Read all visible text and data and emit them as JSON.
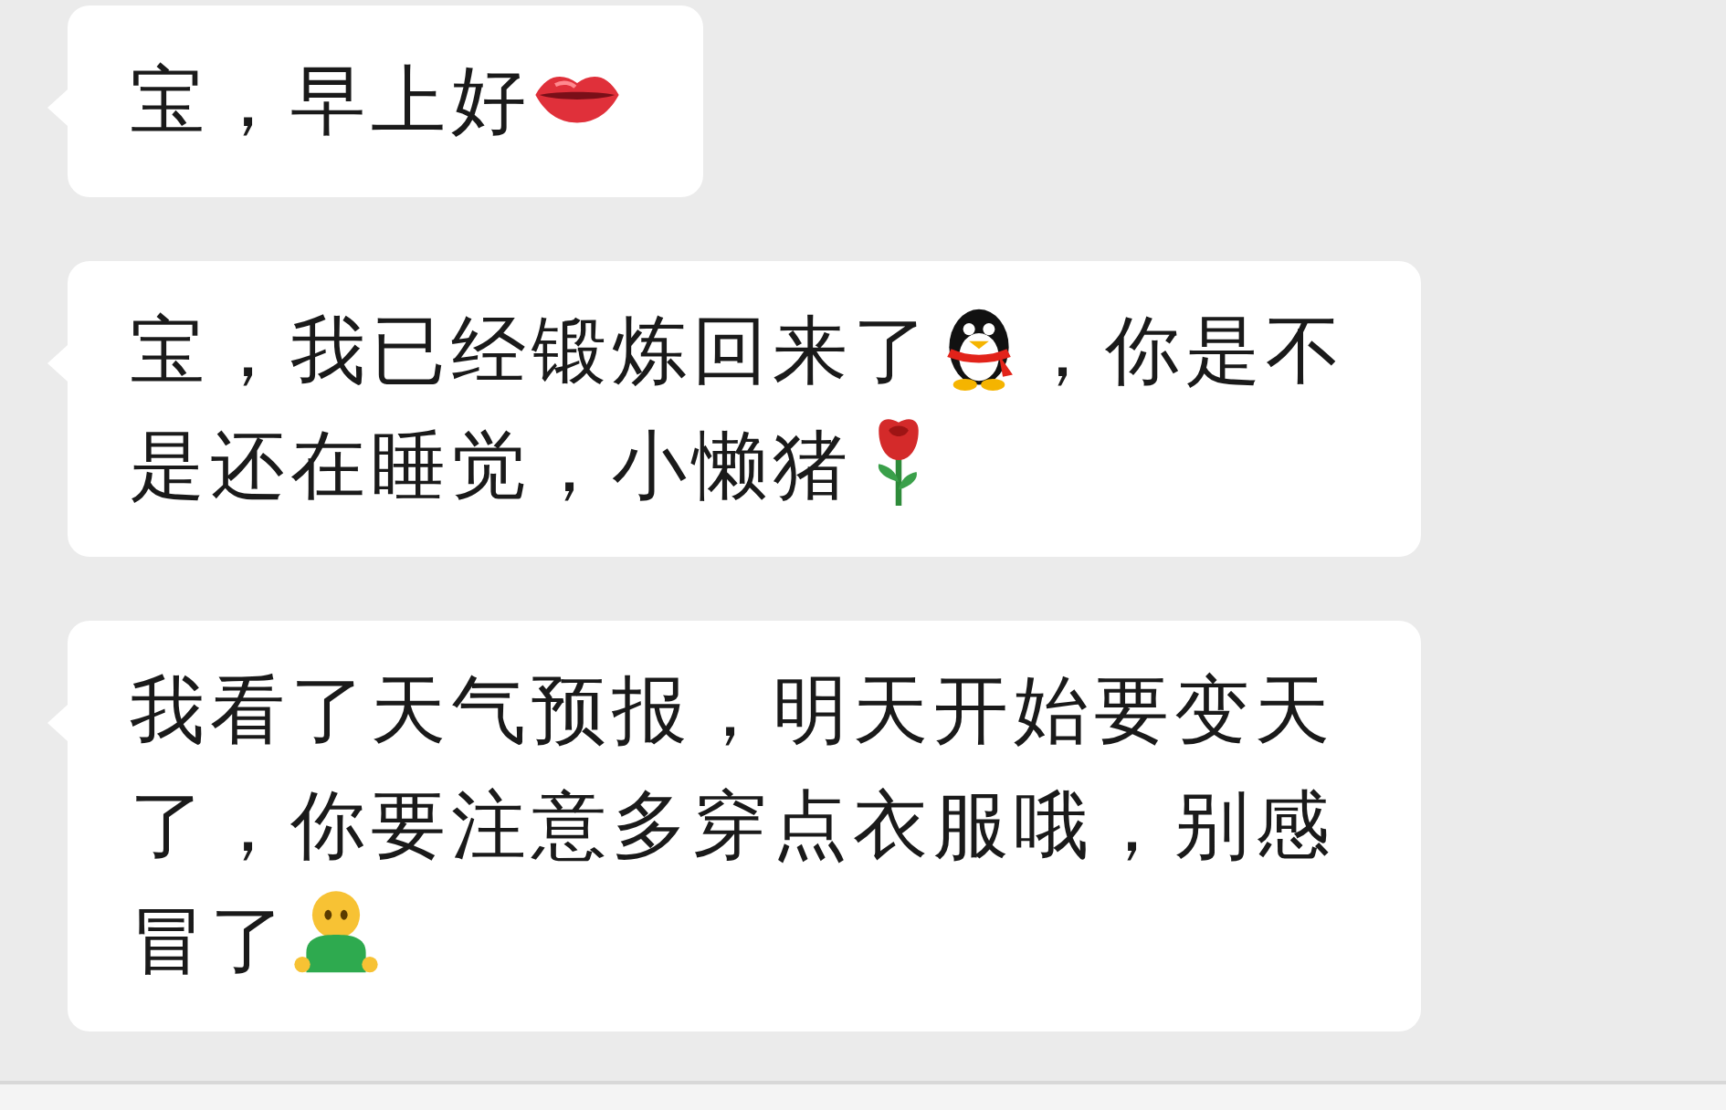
{
  "messages": [
    {
      "lines": [
        [
          {
            "kind": "text",
            "text": "宝，早上好"
          },
          {
            "kind": "lips"
          }
        ]
      ]
    },
    {
      "lines": [
        [
          {
            "kind": "text",
            "text": "宝，我已经锻炼回来了"
          },
          {
            "kind": "penguin"
          },
          {
            "kind": "text",
            "text": "，你是不"
          }
        ],
        [
          {
            "kind": "text",
            "text": "是还在睡觉，小懒猪"
          },
          {
            "kind": "rose"
          }
        ]
      ]
    },
    {
      "lines": [
        [
          {
            "kind": "text",
            "text": "我看了天气预报，明天开始要变天"
          }
        ],
        [
          {
            "kind": "text",
            "text": "了，你要注意多穿点衣服哦，别感"
          }
        ],
        [
          {
            "kind": "text",
            "text": "冒了"
          },
          {
            "kind": "figure"
          }
        ]
      ]
    }
  ]
}
